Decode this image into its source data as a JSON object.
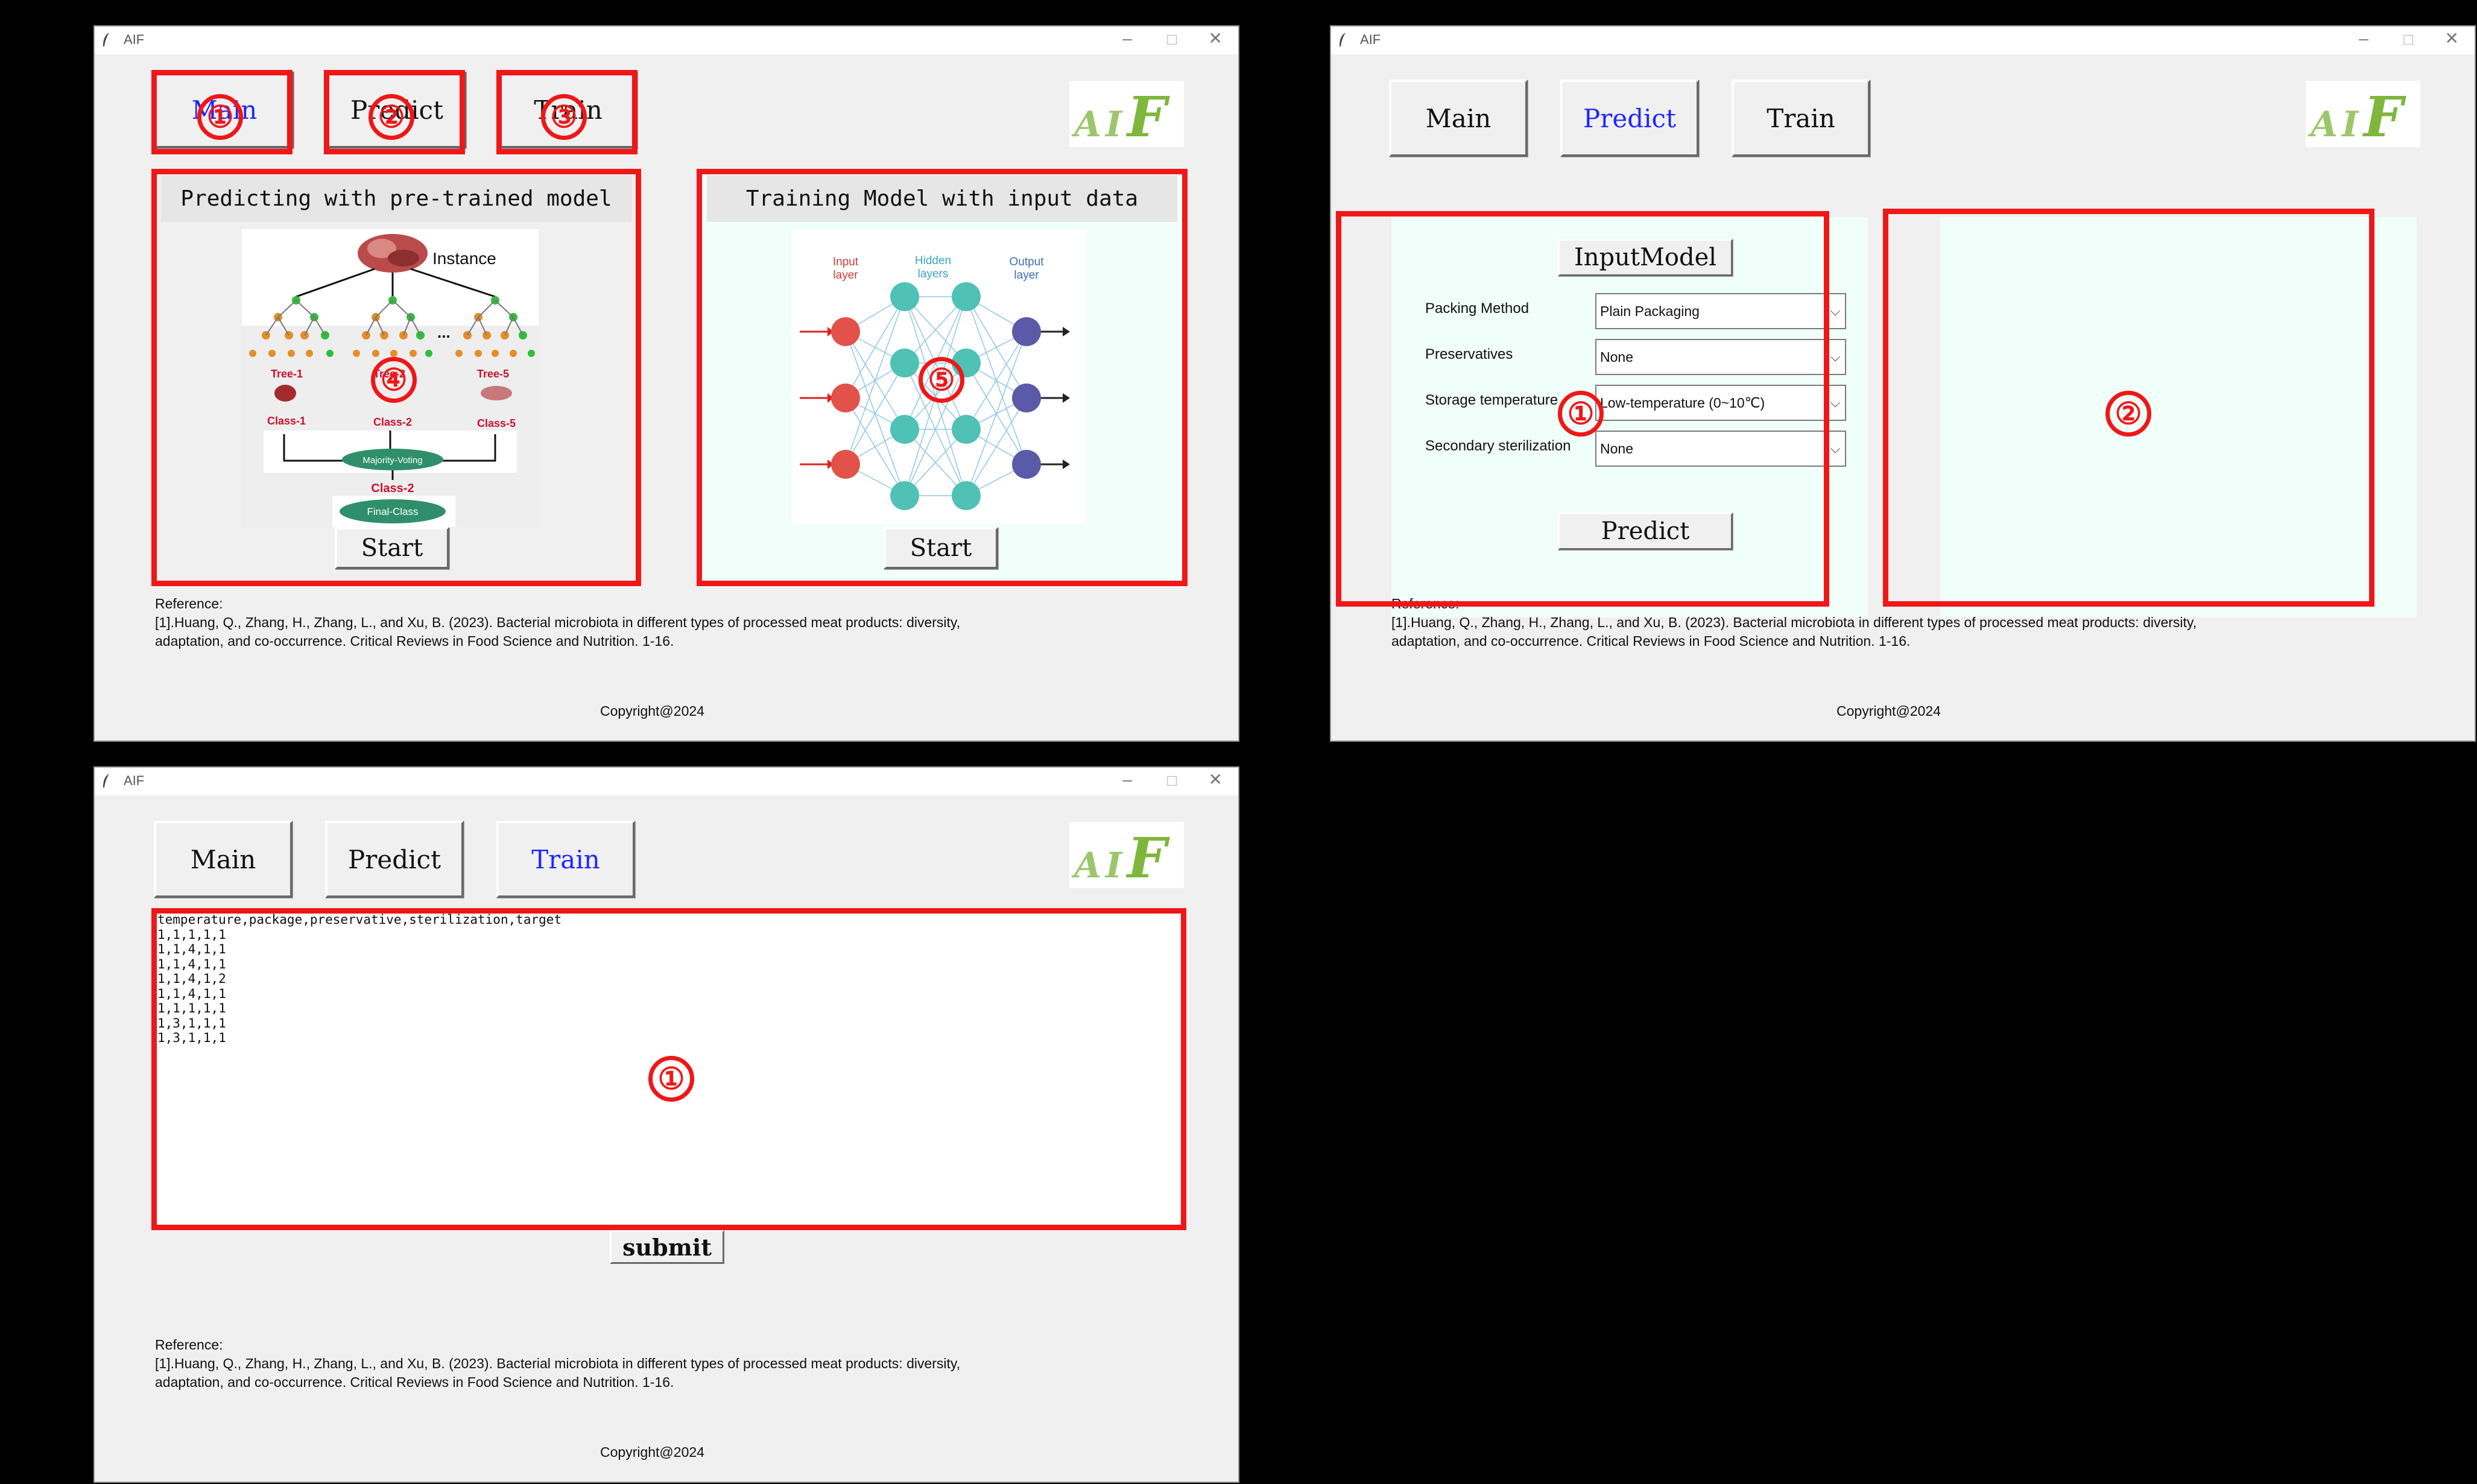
{
  "window_title": "AIF",
  "window_controls": {
    "minimize": "–",
    "maximize": "☐",
    "close": "✕"
  },
  "nav": {
    "main": "Main",
    "predict": "Predict",
    "train": "Train"
  },
  "logo_text": {
    "a": "A",
    "i": "I",
    "f": "F"
  },
  "main_view": {
    "predict_panel": {
      "title": "Predicting with pre-trained model",
      "start_label": "Start",
      "figure": {
        "instance": "Instance",
        "dots": "...",
        "trees": [
          "Tree-1",
          "Tree-2",
          "Tree-5"
        ],
        "classes": [
          "Class-1",
          "Class-2",
          "Class-5"
        ],
        "majority": "Majority-Voting",
        "result_class": "Class-2",
        "final": "Final-Class"
      }
    },
    "train_panel": {
      "title": "Training Model with input data",
      "start_label": "Start",
      "figure": {
        "input_layer": [
          "Input",
          "layer"
        ],
        "hidden_layers": [
          "Hidden",
          "layers"
        ],
        "output_layer": [
          "Output",
          "layer"
        ]
      }
    }
  },
  "predict_view": {
    "input_model_label": "InputModel",
    "fields": [
      {
        "label": "Packing Method",
        "value": "Plain Packaging"
      },
      {
        "label": "Preservatives",
        "value": "None"
      },
      {
        "label": "Storage temperature",
        "value": "Low-temperature (0~10℃)"
      },
      {
        "label": "Secondary sterilization",
        "value": "None"
      }
    ],
    "predict_label": "Predict"
  },
  "train_view": {
    "csv_lines": [
      "temperature,package,preservative,sterilization,target",
      "1,1,1,1,1",
      "1,1,4,1,1",
      "1,1,4,1,1",
      "1,1,4,1,2",
      "1,1,4,1,1",
      "1,1,1,1,1",
      "1,3,1,1,1",
      "1,3,1,1,1"
    ],
    "submit_label": "submit"
  },
  "reference": {
    "heading": "Reference:",
    "line1": "[1].Huang, Q., Zhang, H., Zhang, L., and Xu, B. (2023). Bacterial microbiota in different types of processed meat products: diversity,",
    "line2": "adaptation, and co-occurrence. Critical Reviews in Food Science and Nutrition. 1-16."
  },
  "copyright": "Copyright@2024",
  "annotation_markers": {
    "main": [
      "①",
      "②",
      "③",
      "④",
      "⑤"
    ],
    "predict": [
      "①",
      "②"
    ],
    "train": [
      "①"
    ]
  },
  "colors": {
    "active_nav": "#1f25ff",
    "annotation_red": "#ef1717",
    "panel_bg": "#f0fffa",
    "window_bg": "#f0f0f0"
  }
}
